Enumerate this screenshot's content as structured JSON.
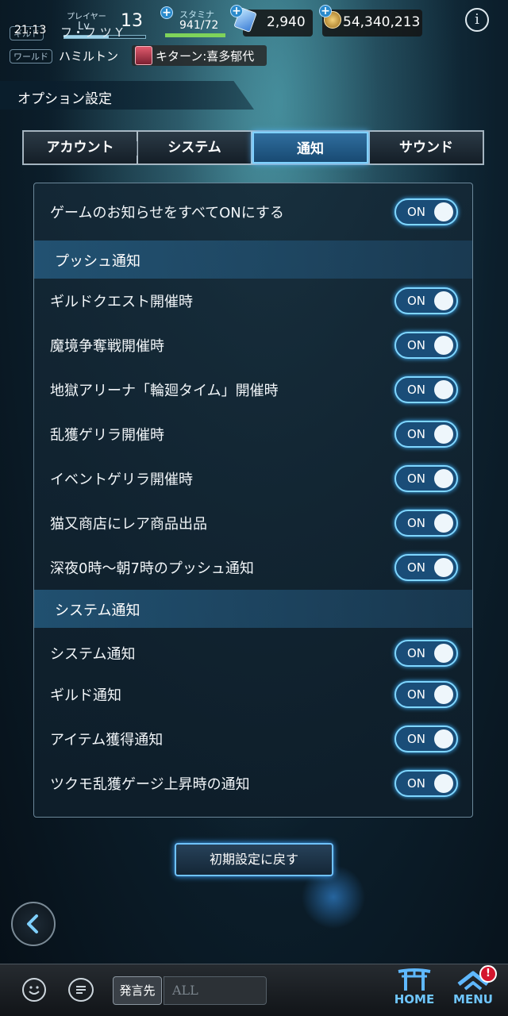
{
  "header": {
    "time": "21:13",
    "player_label": "プレイヤー",
    "level_prefix": "Lv",
    "level": "13",
    "level_progress": 0.55,
    "guild_tag": "ギルド",
    "guild_name": "フ・フ ツ Y",
    "world_tag": "ワールド",
    "world_name": "ハミルトン",
    "character_name": "キターン:喜多郁代",
    "stamina_label": "スタミナ",
    "stamina_value": "941/72",
    "stamina_progress": 1.0,
    "gems": "2,940",
    "coins": "54,340,213",
    "info_icon": "i"
  },
  "title": "オプション設定",
  "tabs": [
    {
      "label": "アカウント",
      "active": false
    },
    {
      "label": "システム",
      "active": false
    },
    {
      "label": "通知",
      "active": true
    },
    {
      "label": "サウンド",
      "active": false
    }
  ],
  "panel": {
    "master": {
      "label": "ゲームのお知らせをすべてONにする",
      "state": "ON"
    },
    "push_section": "プッシュ通知",
    "push_items": [
      {
        "label": "ギルドクエスト開催時",
        "state": "ON"
      },
      {
        "label": "魔境争奪戦開催時",
        "state": "ON"
      },
      {
        "label": "地獄アリーナ「輪廻タイム」開催時",
        "state": "ON"
      },
      {
        "label": "乱獲ゲリラ開催時",
        "state": "ON"
      },
      {
        "label": "イベントゲリラ開催時",
        "state": "ON"
      },
      {
        "label": "猫又商店にレア商品出品",
        "state": "ON"
      },
      {
        "label": "深夜0時～朝7時のプッシュ通知",
        "state": "ON"
      }
    ],
    "system_section": "システム通知",
    "system_items": [
      {
        "label": "システム通知",
        "state": "ON"
      },
      {
        "label": "ギルド通知",
        "state": "ON"
      },
      {
        "label": "アイテム獲得通知",
        "state": "ON"
      },
      {
        "label": "ツクモ乱獲ゲージ上昇時の通知",
        "state": "ON"
      }
    ]
  },
  "reset_button": "初期設定に戻す",
  "bottom": {
    "to_label": "発言先",
    "chat_value": "ALL",
    "home_label": "HOME",
    "menu_label": "MENU",
    "menu_badge": "!"
  },
  "colors": {
    "accent": "#6fc6ff",
    "toggle_on": "#1a4d78",
    "badge": "#d4162e"
  }
}
